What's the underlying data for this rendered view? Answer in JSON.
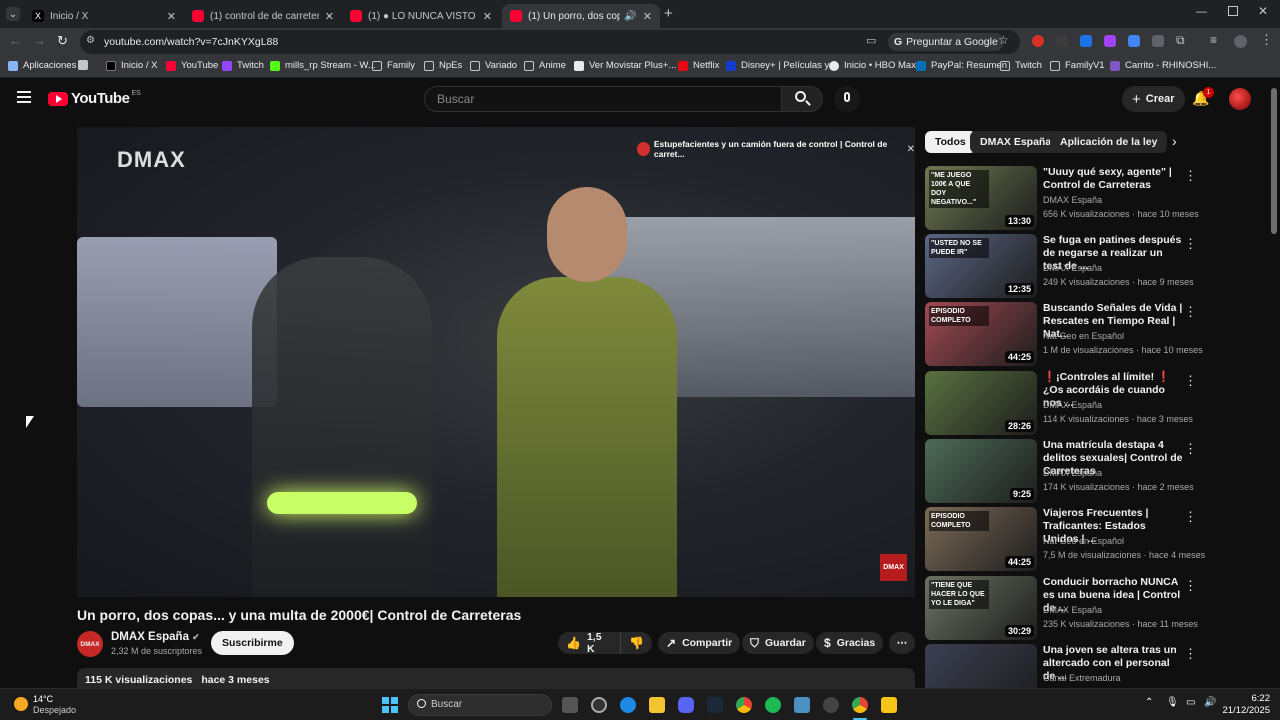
{
  "tabs": [
    {
      "title": "Inicio / X"
    },
    {
      "title": "(1) control de de carreteras 09..."
    },
    {
      "title": "(1) ● LO NUNCA VISTO ● de..."
    },
    {
      "title": "(1) Un porro, dos copas... y"
    }
  ],
  "address": {
    "url": "youtube.com/watch?v=7cJnKYXgL88",
    "ask_google": "Preguntar a Google"
  },
  "bookmarks": [
    "Aplicaciones",
    "Inicio / X",
    "YouTube",
    "Twitch",
    "mills_rp Stream - W...",
    "Family",
    "NpEs",
    "Variado",
    "Anime",
    "Ver Movistar Plus+...",
    "Netflix",
    "Disney+ | Películas y...",
    "Inicio • HBO Max",
    "PayPal: Resumen",
    "Twitch",
    "FamilyV1",
    "Carrito - RHINOSHI..."
  ],
  "masthead": {
    "logo_text": "YouTube",
    "region": "ES",
    "search_placeholder": "Buscar",
    "create_label": "Crear",
    "notif_count": "1"
  },
  "player": {
    "watermark": "DMAX",
    "overlay_title": "Estupefacientes y un camión fuera de control | Control de carret...",
    "corner_logo": "DMAX"
  },
  "video": {
    "title": "Un porro, dos copas... y una multa de 2000€| Control de Carreteras",
    "channel": "DMAX España",
    "subscribers": "2,32 M de suscriptores",
    "subscribe_label": "Suscribirme",
    "likes": "1,5 K",
    "share_label": "Compartir",
    "save_label": "Guardar",
    "thanks_label": "Gracias",
    "views": "115 K visualizaciones",
    "age": "hace 3 meses"
  },
  "chips": [
    "Todos",
    "DMAX España",
    "Aplicación de la ley"
  ],
  "recommendations": [
    {
      "title": "\"Uuuy qué sexy, agente\" | Control de Carreteras",
      "channel": "DMAX España",
      "meta": "656 K visualizaciones · hace 10 meses",
      "duration": "13:30",
      "thumb_text": "\"ME JUEGO 100€ A QUE DOY NEGATIVO...\"",
      "color": "#6f7a52"
    },
    {
      "title": "Se fuga en patines después de negarse a realizar un test de ...",
      "channel": "DMAX España",
      "meta": "249 K visualizaciones · hace 9 meses",
      "duration": "12:35",
      "thumb_text": "\"USTED NO SE PUEDE IR\"",
      "color": "#5d6786"
    },
    {
      "title": "Buscando Señales de Vida | Rescates en Tiempo Real | Nat...",
      "channel": "Nat Geo en Español",
      "meta": "1 M de visualizaciones · hace 10 meses",
      "duration": "44:25",
      "thumb_text": "EPISODIO COMPLETO",
      "color": "#a14a52"
    },
    {
      "title": "❗¡Controles al límite! ❗ ¿Os acordáis de cuando nos ...",
      "channel": "DMAX España",
      "meta": "114 K visualizaciones · hace 3 meses",
      "duration": "28:26",
      "thumb_text": "",
      "color": "#59713f"
    },
    {
      "title": "Una matrícula destapa 4 delitos sexuales| Control de Carreteras",
      "channel": "DMAX España",
      "meta": "174 K visualizaciones · hace 2 meses",
      "duration": "9:25",
      "thumb_text": "",
      "color": "#4d6b59"
    },
    {
      "title": "Viajeros Frecuentes | Traficantes: Estados Unidos | ...",
      "channel": "Nat Geo en Español",
      "meta": "7,5 M de visualizaciones · hace 4 meses",
      "duration": "44:25",
      "thumb_text": "EPISODIO COMPLETO",
      "color": "#7c6b58"
    },
    {
      "title": "Conducir borracho NUNCA es una buena idea | Control de ...",
      "channel": "DMAX España",
      "meta": "235 K visualizaciones · hace 11 meses",
      "duration": "30:29",
      "thumb_text": "\"TIENE QUE HACER LO QUE YO LE DIGA\"",
      "color": "#6d7364"
    },
    {
      "title": "Una joven se altera tras un altercado con el personal de ...",
      "channel": "Canal Extremadura",
      "meta": "",
      "duration": "",
      "thumb_text": "",
      "color": "#3b3f52"
    }
  ],
  "taskbar": {
    "weather_temp": "14°C",
    "weather_desc": "Despejado",
    "search_placeholder": "Buscar",
    "time": "6:22",
    "date": "21/12/2025"
  }
}
